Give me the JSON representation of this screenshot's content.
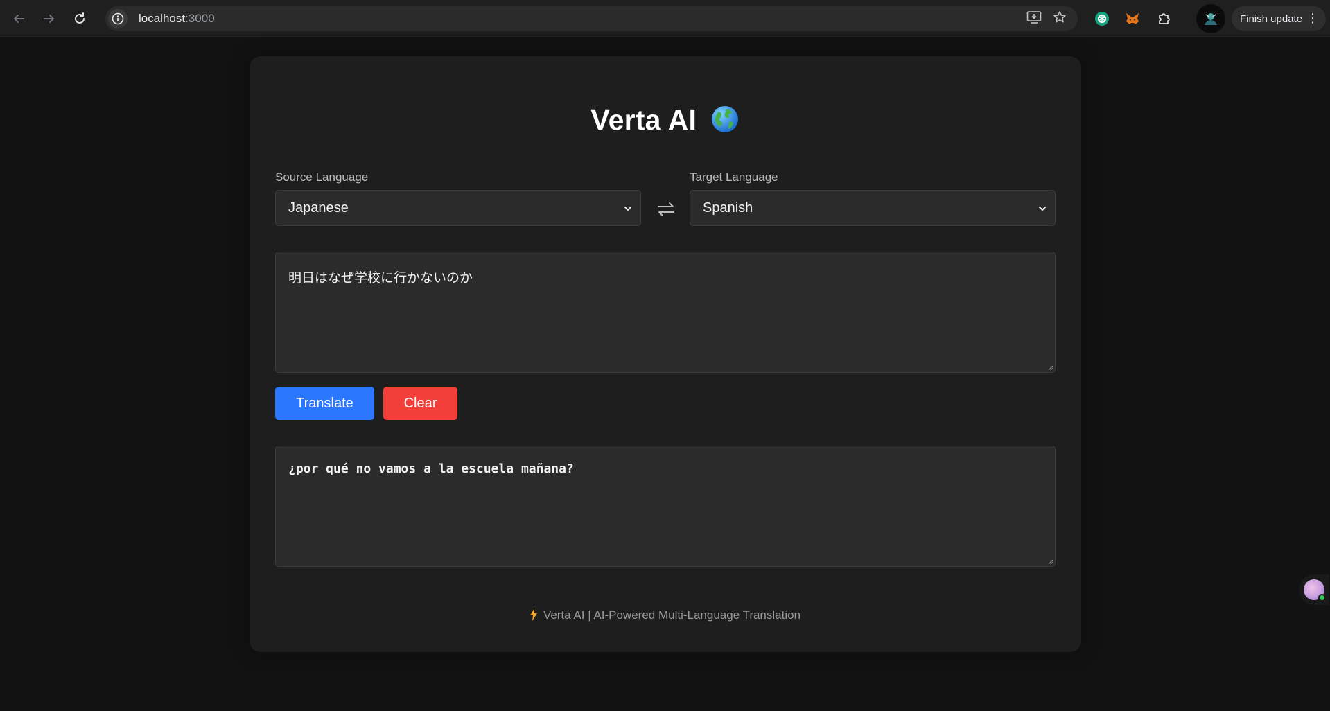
{
  "browser": {
    "url_host": "localhost",
    "url_port": ":3000",
    "finish_update_label": "Finish update",
    "extensions": [
      "chatgpt-icon",
      "metamask-fox-icon",
      "puzzle-icon"
    ]
  },
  "app": {
    "title": "Verta AI",
    "title_emoji_icon": "globe-icon",
    "source_label": "Source Language",
    "source_value": "Japanese",
    "target_label": "Target Language",
    "target_value": "Spanish",
    "input_text": "明日はなぜ学校に行かないのか",
    "translate_label": "Translate",
    "clear_label": "Clear",
    "output_text": "¿por qué no vamos a la escuela mañana?",
    "footer_text": "Verta AI | AI-Powered Multi-Language Translation"
  },
  "colors": {
    "page_bg": "#121212",
    "card_bg": "#1e1e1e",
    "field_bg": "#2b2b2b",
    "translate_button": "#2b78ff",
    "clear_button": "#f23f3a",
    "footer_bolt": "#f5a623"
  }
}
